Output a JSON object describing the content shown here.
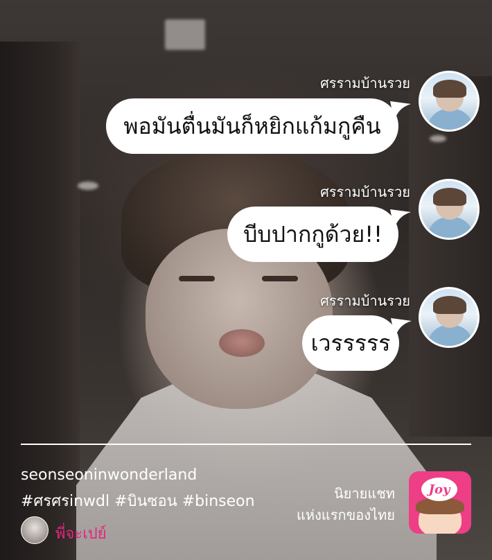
{
  "messages": [
    {
      "sender": "ศรรามบ้านรวย",
      "text": "พอมันตื่นมันก็หยิกแก้มกูคืน"
    },
    {
      "sender": "ศรรามบ้านรวย",
      "text": "บีบปากกูด้วย!!"
    },
    {
      "sender": "ศรรามบ้านรวย",
      "text": "เวรรรรร"
    }
  ],
  "footer": {
    "username": "seonseoninwonderland",
    "hashtags": "#ศรศรinwdl #บินซอน #binseon",
    "author_name": "พี่จะเปย์",
    "promo_line1": "นิยายแชท",
    "promo_line2": "แห่งแรกของไทย",
    "logo_text": "Joy"
  },
  "colors": {
    "bubble_bg": "#ffffff",
    "author_name": "#e4247c",
    "logo_bg": "#ee3e86"
  }
}
